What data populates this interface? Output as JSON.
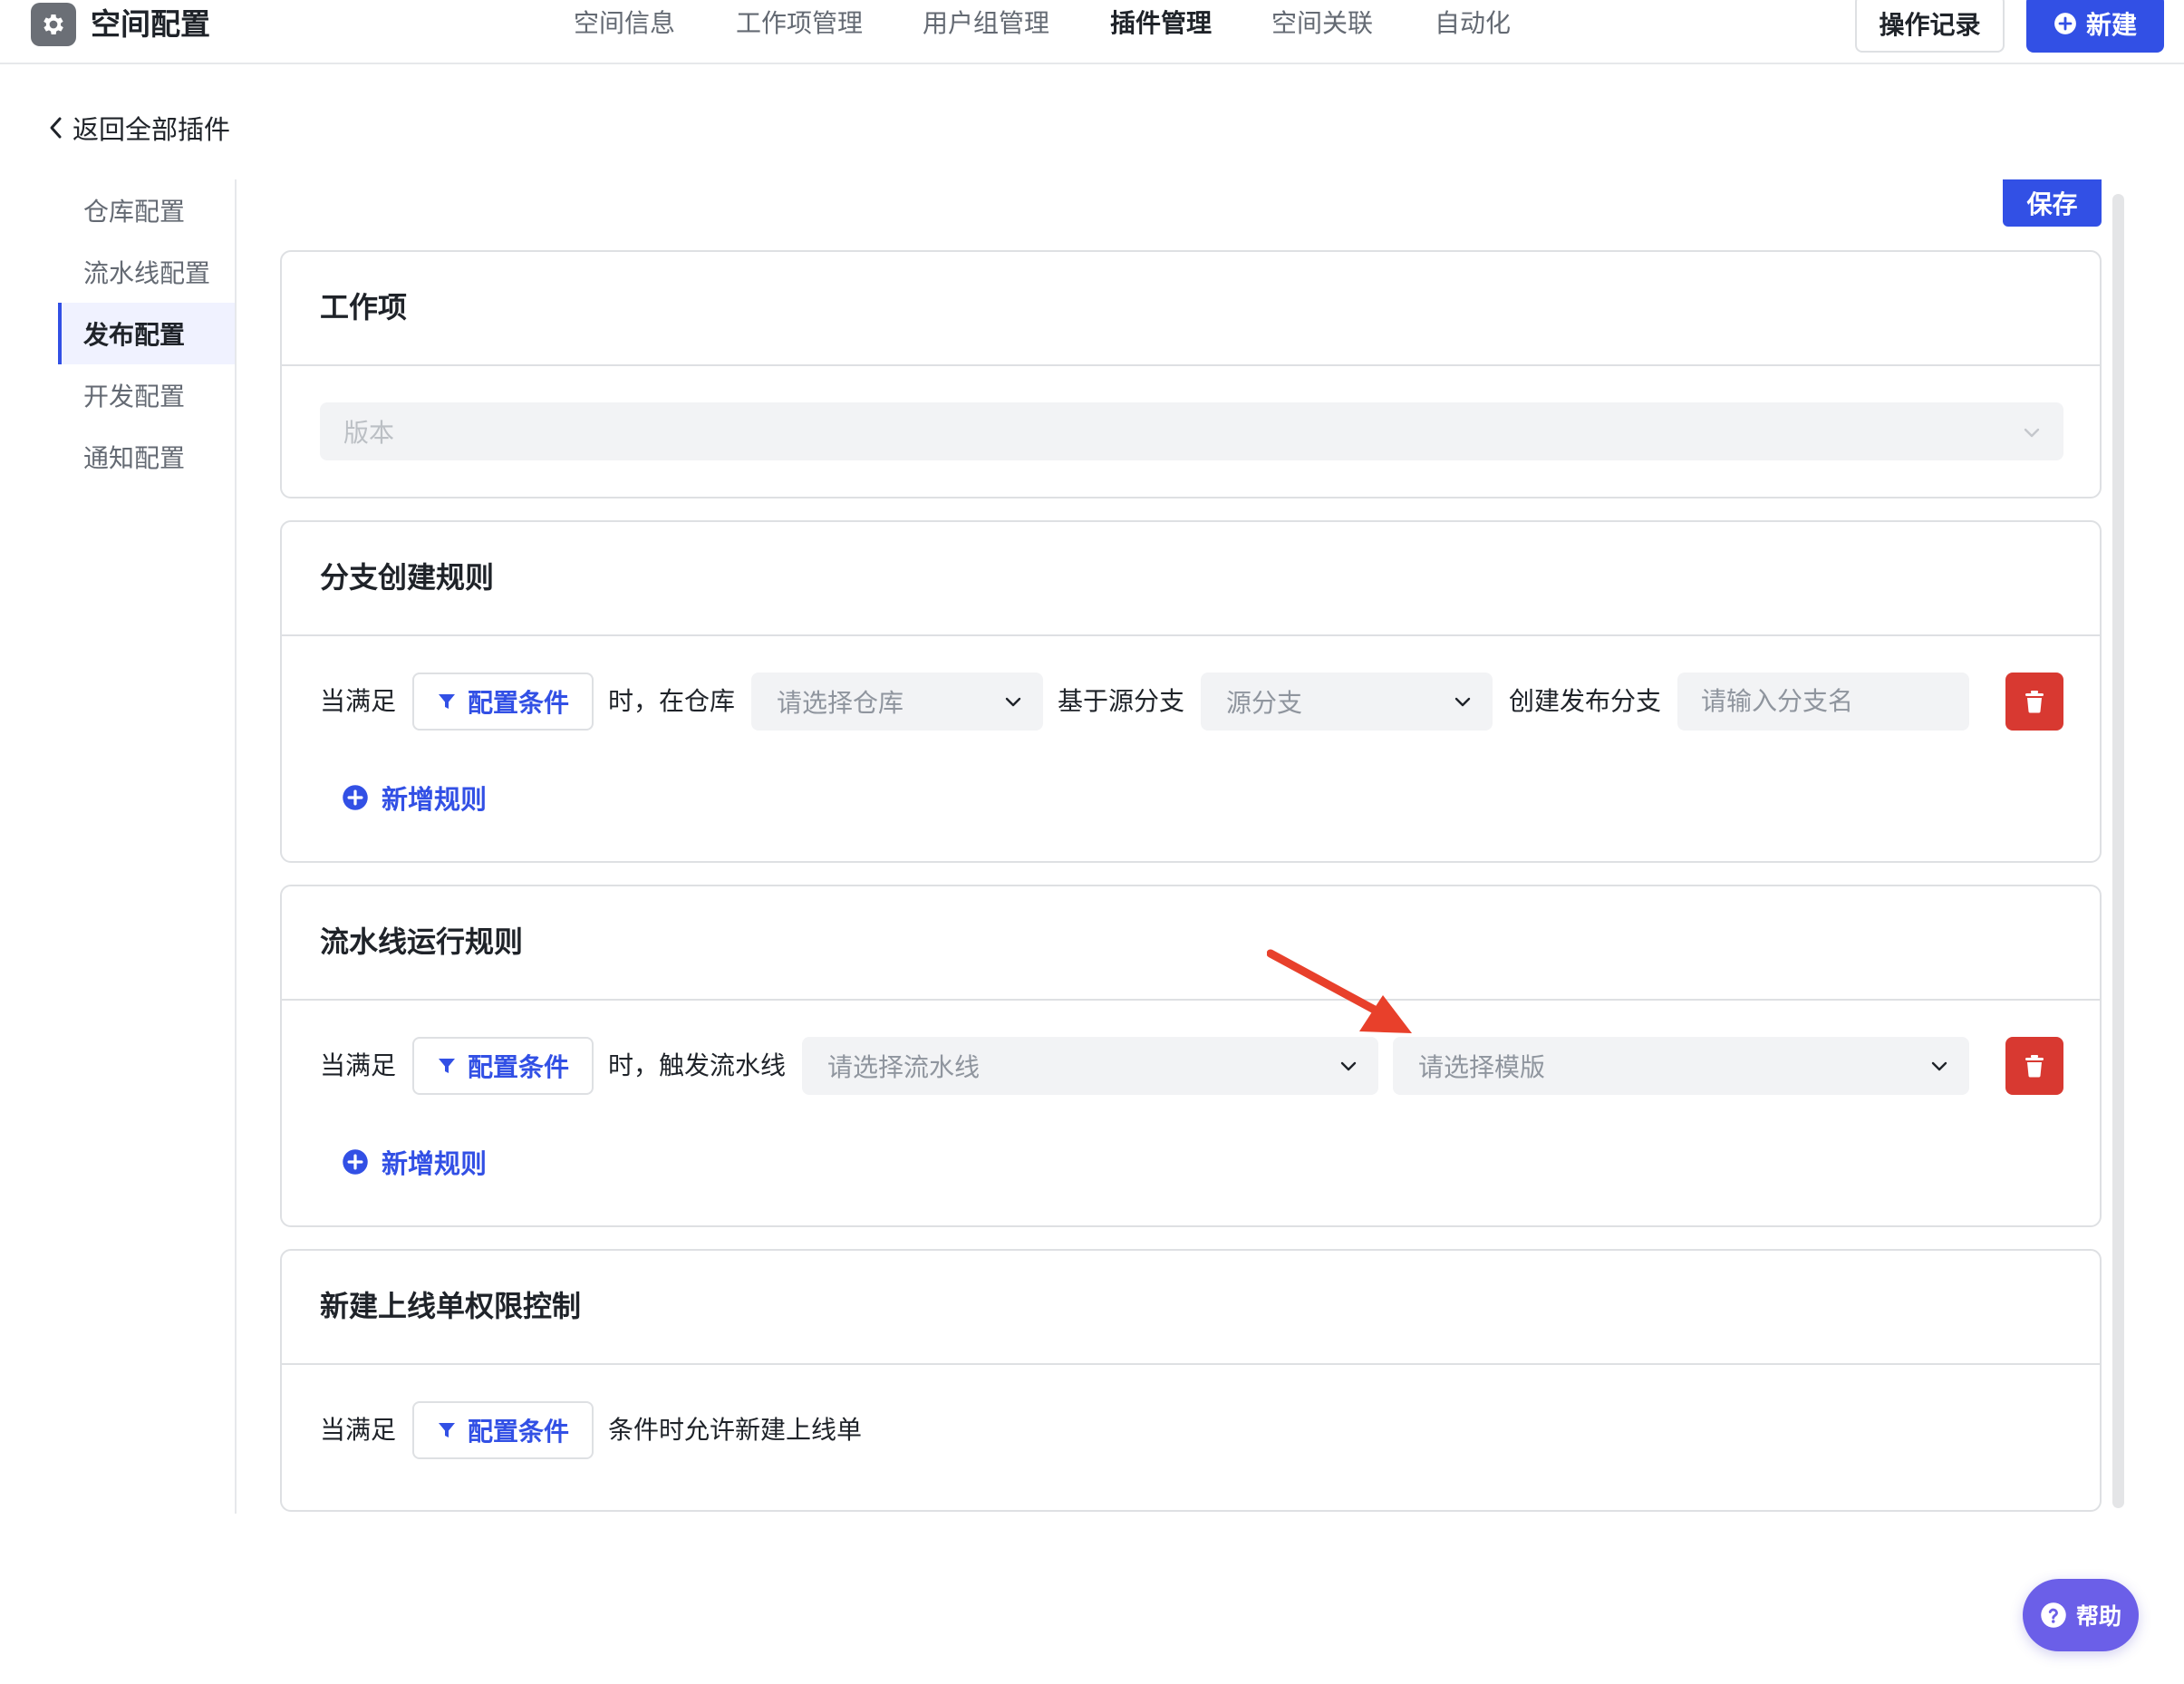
{
  "header": {
    "app_title": "空间配置",
    "app_icon": "gear-icon",
    "tabs": [
      {
        "label": "空间信息",
        "active": false
      },
      {
        "label": "工作项管理",
        "active": false
      },
      {
        "label": "用户组管理",
        "active": false
      },
      {
        "label": "插件管理",
        "active": true
      },
      {
        "label": "空间关联",
        "active": false
      },
      {
        "label": "自动化",
        "active": false
      }
    ],
    "history_label": "操作记录",
    "new_label": "新建"
  },
  "back_link": {
    "label": "返回全部插件"
  },
  "side_menu": {
    "items": [
      {
        "label": "仓库配置",
        "active": false
      },
      {
        "label": "流水线配置",
        "active": false
      },
      {
        "label": "发布配置",
        "active": true
      },
      {
        "label": "开发配置",
        "active": false
      },
      {
        "label": "通知配置",
        "active": false
      }
    ]
  },
  "save_label": "保存",
  "work_item": {
    "title": "工作项",
    "select_placeholder": "版本"
  },
  "branch_rules": {
    "title": "分支创建规则",
    "when_label": "当满足",
    "condition_button": "配置条件",
    "in_repo_label": "时，在仓库",
    "repo_placeholder": "请选择仓库",
    "based_on_label": "基于源分支",
    "source_branch_placeholder": "源分支",
    "create_label": "创建发布分支",
    "branch_name_placeholder": "请输入分支名",
    "add_rule": "新增规则"
  },
  "pipeline_rules": {
    "title": "流水线运行规则",
    "when_label": "当满足",
    "condition_button": "配置条件",
    "trigger_label": "时，触发流水线",
    "pipeline_placeholder": "请选择流水线",
    "template_placeholder": "请选择模版",
    "add_rule": "新增规则"
  },
  "release_permission": {
    "title": "新建上线单权限控制",
    "when_label": "当满足",
    "condition_button": "配置条件",
    "allow_label": "条件时允许新建上线单"
  },
  "help_label": "帮助",
  "colors": {
    "primary": "#3250e5",
    "danger": "#d83931",
    "help": "#6b5fe8",
    "annotation": "#e8402b"
  }
}
